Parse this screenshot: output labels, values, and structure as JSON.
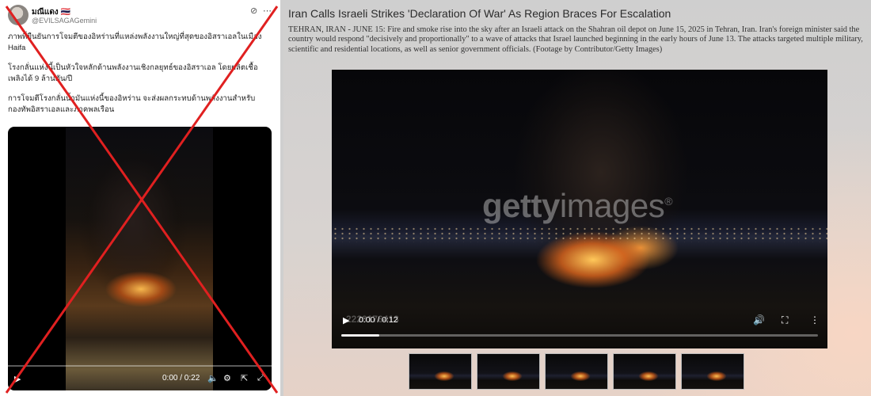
{
  "post": {
    "display_name": "มณีแดง 🇹🇭",
    "handle": "@EVILSAGAGemini",
    "paragraphs": [
      "ภาพที่ยืนยันการโจมตีของอิหร่านที่แหล่งพลังงานใหญ่ที่สุดของอิสราเอลในเมือง Haifa",
      "โรงกลั่นแห่งนี้เป็นหัวใจหลักด้านพลังงานเชิงกลยุทธ์ของอิสราเอล โดยผลิตเชื้อเพลิงได้ 9 ล้านตัน/ปี",
      "การโจมตีโรงกลั่นน้ำมันแห่งนี้ของอิหร่าน จะส่งผลกระทบด้านพลังงานสำหรับกองทัพอิสราเอลและภาคพลเรือน"
    ],
    "video": {
      "time": "0:00 / 0:22"
    },
    "icons": [
      "grok-icon",
      "more-icon",
      "play-icon",
      "mute-icon",
      "settings-icon",
      "share-icon",
      "fullscreen-icon"
    ],
    "overlay_color": "#e02020"
  },
  "getty": {
    "title": "Iran Calls Israeli Strikes 'Declaration Of War' As Region Braces For Escalation",
    "caption": "TEHRAN, IRAN - JUNE 15: Fire and smoke rise into the sky after an Israeli attack on the Shahran oil depot on June 15, 2025 in Tehran, Iran. Iran's foreign minister said the country would respond \"decisively and proportionally\" to a wave of attacks that Israel launched beginning in the early hours of June 13. The attacks targeted multiple military, scientific and residential locations, as well as senior government officials. (Footage by Contributor/Getty Images)",
    "video": {
      "watermark_bold": "getty",
      "watermark_light": "images",
      "watermark_mark": "®",
      "asset_id": "2220176413",
      "time": "0:00 / 0:12",
      "progress": 0.08
    },
    "thumbnails": 5,
    "icons": [
      "play-icon",
      "volume-icon",
      "fullscreen-icon",
      "more-vertical-icon"
    ]
  }
}
